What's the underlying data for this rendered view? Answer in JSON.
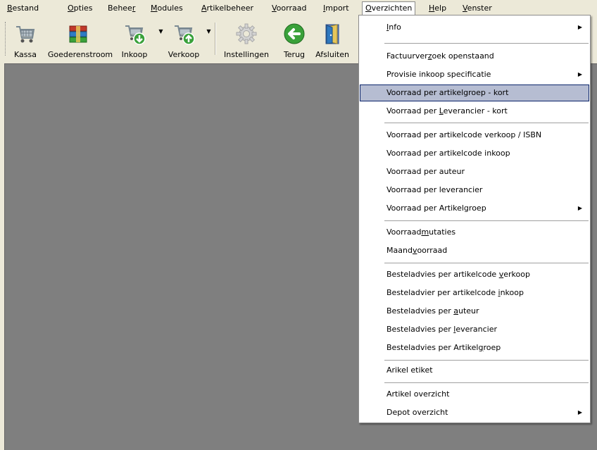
{
  "menubar": {
    "items": [
      {
        "pre": "",
        "key": "B",
        "post": "estand"
      },
      {
        "pre": "",
        "key": "O",
        "post": "pties"
      },
      {
        "pre": "Behee",
        "key": "r",
        "post": ""
      },
      {
        "pre": "",
        "key": "M",
        "post": "odules"
      },
      {
        "pre": "",
        "key": "A",
        "post": "rtikelbeheer"
      },
      {
        "pre": "",
        "key": "V",
        "post": "oorraad"
      },
      {
        "pre": "",
        "key": "I",
        "post": "mport"
      },
      {
        "pre": "",
        "key": "O",
        "post": "verzichten"
      },
      {
        "pre": "",
        "key": "H",
        "post": "elp"
      },
      {
        "pre": "",
        "key": "V",
        "post": "enster"
      }
    ]
  },
  "toolbar": {
    "buttons": [
      {
        "label": "Kassa",
        "icon": "cart-icon"
      },
      {
        "label": "Goederenstroom",
        "icon": "boxes-icon"
      },
      {
        "label": "Inkoop",
        "icon": "cart-down-icon"
      },
      {
        "label": "Verkoop",
        "icon": "cart-up-icon"
      },
      {
        "label": "Instellingen",
        "icon": "gear-icon"
      },
      {
        "label": "Terug",
        "icon": "back-arrow-icon"
      },
      {
        "label": "Afsluiten",
        "icon": "exit-door-icon"
      }
    ],
    "dropdown_arrow": "▼",
    "colors": {
      "green": "#3aa13a",
      "cart_gray": "#9aa6ae",
      "boxes_red": "#c0392b"
    }
  },
  "dropdown": {
    "submenu_arrow": "▶",
    "highlight_color": "#b6bdd2",
    "items": [
      {
        "pre": "",
        "key": "I",
        "post": "nfo",
        "submenu": true
      },
      {
        "pre": "Factuurver",
        "key": "z",
        "post": "oek openstaand",
        "submenu": false
      },
      {
        "pre": "Provisie inkoop specificatie",
        "key": "",
        "post": "",
        "submenu": true
      },
      {
        "pre": "Voorraad per artikelgroep - kort",
        "key": "",
        "post": "",
        "submenu": false
      },
      {
        "pre": "Voorraad per ",
        "key": "L",
        "post": "everancier - kort",
        "submenu": false
      },
      {
        "pre": "Voorraad per artikelcode verkoop / ISBN",
        "key": "",
        "post": "",
        "submenu": false
      },
      {
        "pre": "Voorraad per artikelcode inkoop",
        "key": "",
        "post": "",
        "submenu": false
      },
      {
        "pre": "Voorraad per auteur",
        "key": "",
        "post": "",
        "submenu": false
      },
      {
        "pre": "Voorraad per leverancier",
        "key": "",
        "post": "",
        "submenu": false
      },
      {
        "pre": "Voorraad per Artikelgroep",
        "key": "",
        "post": "",
        "submenu": true
      },
      {
        "pre": "Voorraad",
        "key": "m",
        "post": "utaties",
        "submenu": false
      },
      {
        "pre": "Maand",
        "key": "v",
        "post": "oorraad",
        "submenu": false
      },
      {
        "pre": "Besteladvies per artikelcode ",
        "key": "v",
        "post": "erkoop",
        "submenu": false
      },
      {
        "pre": "Besteladvier per artikelcode ",
        "key": "i",
        "post": "nkoop",
        "submenu": false
      },
      {
        "pre": "Besteladvies per ",
        "key": "a",
        "post": "uteur",
        "submenu": false
      },
      {
        "pre": "Besteladvies per ",
        "key": "l",
        "post": "everancier",
        "submenu": false
      },
      {
        "pre": "Besteladvies per Artikel",
        "key": "g",
        "post": "roep",
        "submenu": false
      },
      {
        "pre": "Arikel etiket",
        "key": "",
        "post": "",
        "submenu": false
      },
      {
        "pre": "Artikel overzicht",
        "key": "",
        "post": "",
        "submenu": false
      },
      {
        "pre": "Depot overzicht",
        "key": "",
        "post": "",
        "submenu": true
      }
    ]
  }
}
